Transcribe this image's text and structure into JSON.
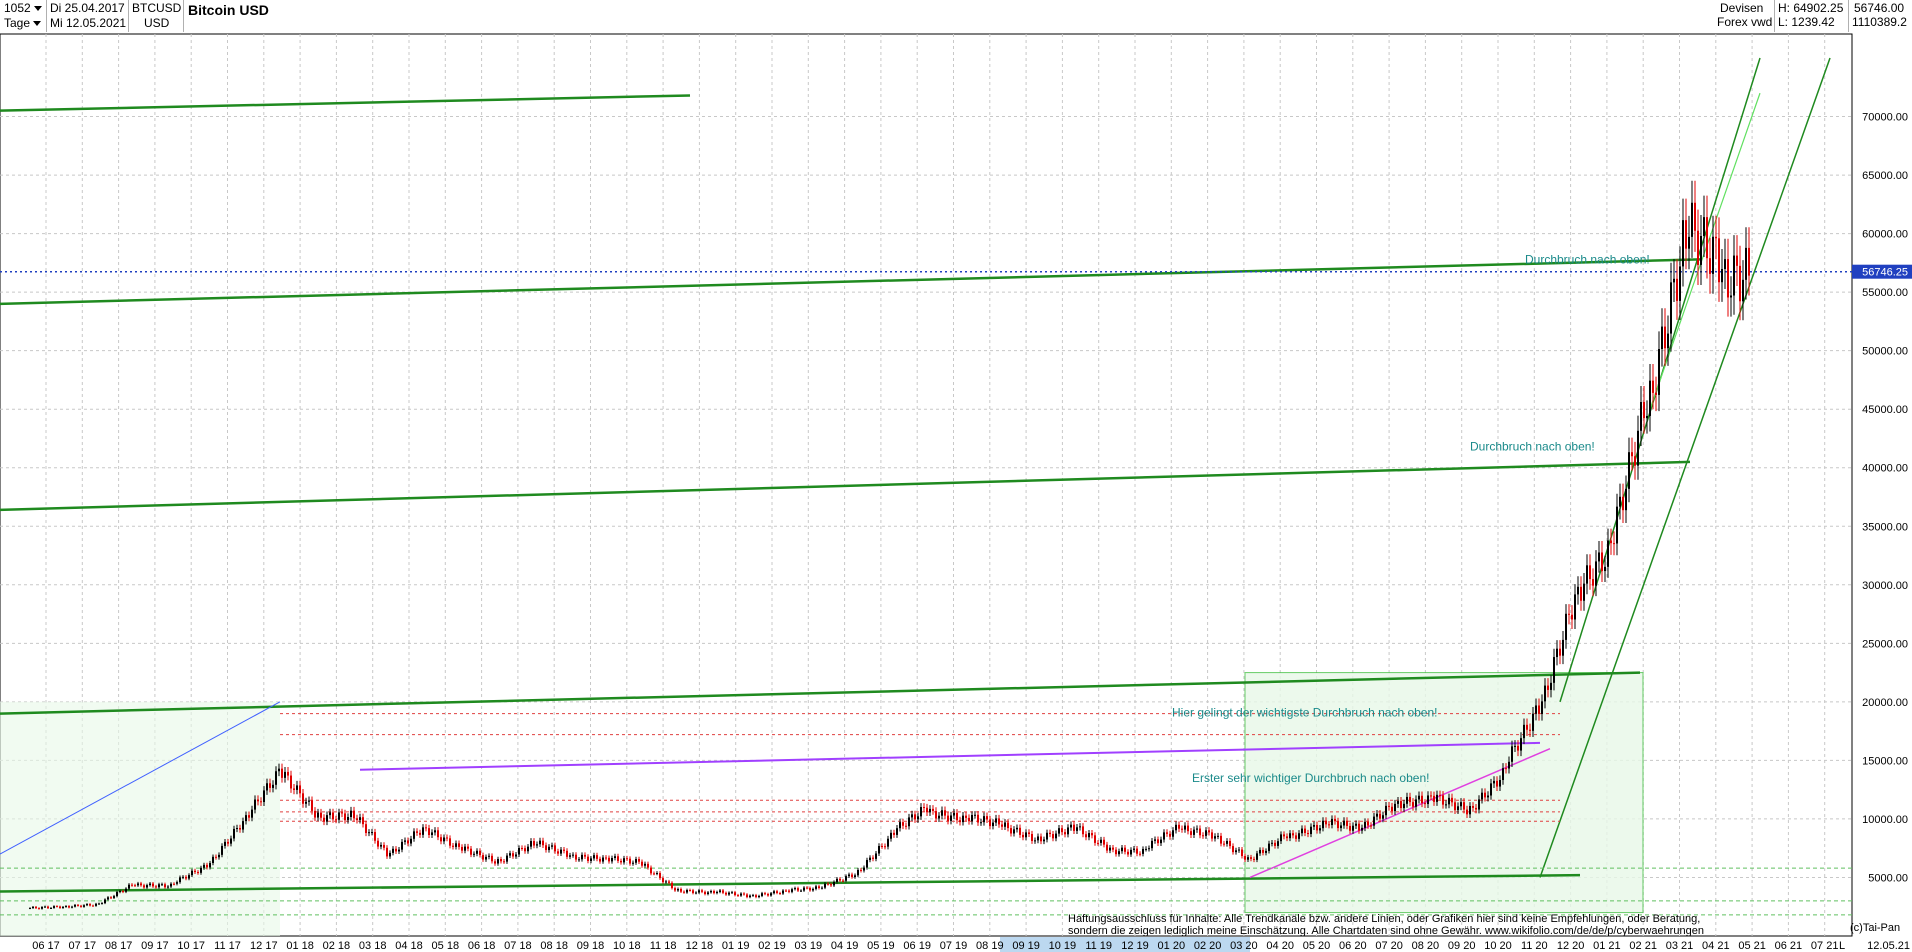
{
  "toolbar": {
    "count_value": "1052",
    "period_value": "Tage",
    "date_from": "Di 25.04.2017",
    "date_to": "Mi 12.05.2021",
    "symbol": "BTCUSD",
    "currency": "USD",
    "title": "Bitcoin USD",
    "category": "Devisen",
    "source": "Forex vwd",
    "high_label": "H: 64902.25",
    "low_label": "L: 1239.42",
    "last_value": "56746.00",
    "volume_value": "1110389.2"
  },
  "colors": {
    "background": "#ffffff",
    "grid": "#c8c8c8",
    "up_candle": "#000000",
    "down_candle": "#e00000",
    "trend_green": "#1f8a1f",
    "trend_purple": "#a040ff",
    "trend_magenta": "#e040e0",
    "price_marker": "#2040c0",
    "annotation": "#1a8a8a"
  },
  "chart_data": {
    "type": "candlestick",
    "title": "Bitcoin USD",
    "ylim": [
      0,
      75000
    ],
    "y_ticks": [
      "5000.00",
      "10000.00",
      "15000.00",
      "20000.00",
      "25000.00",
      "30000.00",
      "35000.00",
      "40000.00",
      "45000.00",
      "50000.00",
      "55000.00",
      "60000.00",
      "65000.00",
      "70000.00"
    ],
    "x_ticks": [
      "06 17",
      "07 17",
      "08 17",
      "09 17",
      "10 17",
      "11 17",
      "12 17",
      "01 18",
      "02 18",
      "03 18",
      "04 18",
      "05 18",
      "06 18",
      "07 18",
      "08 18",
      "09 18",
      "10 18",
      "11 18",
      "12 18",
      "01 19",
      "02 19",
      "03 19",
      "04 19",
      "05 19",
      "06 19",
      "07 19",
      "08 19",
      "09 19",
      "10 19",
      "11 19",
      "12 19",
      "01 20",
      "02 20",
      "03 20",
      "04 20",
      "05 20",
      "06 20",
      "07 20",
      "08 20",
      "09 20",
      "10 20",
      "11 20",
      "12 20",
      "01 21",
      "02 21",
      "03 21",
      "04 21",
      "05 21",
      "06 21",
      "07 21"
    ],
    "x_end_label": "12.05.21",
    "x_log_label": "L",
    "current_price": "56746.25",
    "series": [
      {
        "months": [
          "06 17",
          "07 17",
          "08 17",
          "09 17",
          "10 17",
          "11 17",
          "12 17",
          "01 18",
          "02 18",
          "03 18",
          "04 18",
          "05 18",
          "06 18",
          "07 18",
          "08 18",
          "09 18",
          "10 18",
          "11 18",
          "12 18",
          "01 19",
          "02 19",
          "03 19",
          "04 19",
          "05 19",
          "06 19",
          "07 19",
          "08 19",
          "09 19",
          "10 19",
          "11 19",
          "12 19",
          "01 20",
          "02 20",
          "03 20",
          "04 20",
          "05 20",
          "06 20",
          "07 20",
          "08 20",
          "09 20",
          "10 20",
          "11 20",
          "12 20",
          "01 21",
          "02 21",
          "03 21",
          "04 21",
          "05 21"
        ],
        "close": [
          2500,
          2700,
          4500,
          4300,
          6000,
          9800,
          14000,
          10500,
          10300,
          7000,
          9200,
          7500,
          6400,
          7800,
          7000,
          6600,
          6300,
          4000,
          3700,
          3450,
          3800,
          4100,
          5300,
          8500,
          11000,
          10000,
          9600,
          8300,
          9200,
          7600,
          7200,
          9300,
          8600,
          6400,
          8700,
          9500,
          9200,
          11300,
          11700,
          10800,
          13800,
          19500,
          29000,
          33000,
          46000,
          58800,
          57700,
          56746
        ]
      }
    ],
    "annotations": [
      "Durchbruch nach oben!",
      "Durchbruch nach oben!",
      "Hier gelingt der wichtigste Durchbruch nach oben!",
      "Erster sehr wichtiger Durchbruch nach oben!"
    ],
    "disclaimer": [
      "Haftungsausschluss für Inhalte: Alle Trendkanäle bzw. andere Linien, oder Grafiken hier sind keine Empfehlungen, oder Beratung,",
      "sondern die zeigen lediglich meine  Einschätzung. Alle Chartdaten sind ohne Gewähr.  www.wikifolio.com/de/de/p/cyberwaehrungen"
    ],
    "credit": "(c)Tai-Pan"
  }
}
